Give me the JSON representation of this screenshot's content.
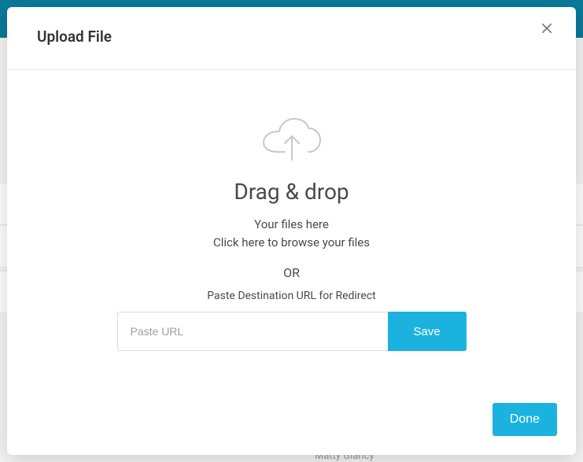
{
  "modal": {
    "title": "Upload File",
    "drag_title": "Drag & drop",
    "files_sub": "Your files here",
    "browse_text": "Click here to browse your files",
    "or_label": "OR",
    "url_label": "Paste Destination URL for Redirect",
    "url_placeholder": "Paste URL",
    "save_label": "Save",
    "done_label": "Done"
  },
  "background": {
    "obscured_name": "Matty Glancy"
  }
}
